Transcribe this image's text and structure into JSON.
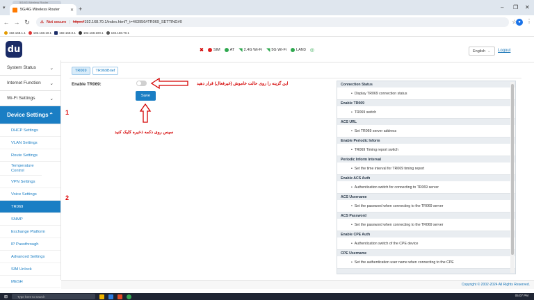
{
  "browser": {
    "tab_title": "5G/4G Wireless Router",
    "ghost_tab": "5G/4G Wireless Router",
    "security_warning": "Not secure",
    "url_scheme": "https://",
    "url_rest": "192.168.70.1/index.html?_t=463956#TR069_SETTING#0",
    "bookmarks": [
      "192.168.1.1",
      "192.168.10.1",
      "192.168.0.1",
      "192.168.100.1",
      "192.168.70.1"
    ]
  },
  "header": {
    "logo_text": "du",
    "status": [
      {
        "label": "",
        "icon": "sim-x-icon",
        "color": "#d00000"
      },
      {
        "label": "SIM",
        "icon": "dot",
        "color": "#e02020"
      },
      {
        "label": "AT",
        "icon": "dot",
        "color": "#2fa84f"
      },
      {
        "label": "2.4G Wi-Fi",
        "icon": "wifi-icon",
        "color": "#2fa84f"
      },
      {
        "label": "5G Wi-Fi",
        "icon": "wifi-icon",
        "color": "#2fa84f"
      },
      {
        "label": "LAN3",
        "icon": "dot",
        "color": "#2fa84f"
      }
    ],
    "language": "English",
    "logout": "Logout"
  },
  "sidebar": {
    "menus": [
      "System Status",
      "Internet Function",
      "Wi-Fi Settings"
    ],
    "active_menu": "Device Settings",
    "items": [
      "DHCP Settings",
      "VLAN Settings",
      "Route Settings",
      "Temperature Control",
      "VPN Settings",
      "Voice Settings",
      "TR069",
      "SNMP",
      "Exchange Platform",
      "IP Passthrough",
      "Advanced Settings",
      "SIM Unlock",
      "MESH"
    ],
    "selected_item": "TR069"
  },
  "content": {
    "tabs": [
      "TR069",
      "TR069Brief"
    ],
    "active_tab": "TR069",
    "enable_label": "Enable TR069:",
    "toggle_state": "off",
    "save_label": "Save"
  },
  "annotations": {
    "num1": "1",
    "num2": "2",
    "text1": "این گزینه را روی حالت خاموش (غیرفعال) قرار دهید",
    "text2": "سپس روی دکمه ذخیره کلیک کنید"
  },
  "help": [
    {
      "title": "Connection Status",
      "desc": "Display TR069 connection status"
    },
    {
      "title": "Enable TR069",
      "desc": "TR069 switch"
    },
    {
      "title": "ACS URL",
      "desc": "Set TR069 server address"
    },
    {
      "title": "Enable Periodic Inform",
      "desc": "TR069 Timing report switch"
    },
    {
      "title": "Periodic Inform Interval",
      "desc": "Set the time interval for TR069 timing report"
    },
    {
      "title": "Enable ACS Auth",
      "desc": "Authentication switch for connecting to TR069 server"
    },
    {
      "title": "ACS Username",
      "desc": "Set the password when connecting to the TR069 server"
    },
    {
      "title": "ACS Password",
      "desc": "Set the password when connecting to the TR069 server"
    },
    {
      "title": "Enable CPE Auth",
      "desc": "Authentication switch of the CPE device"
    },
    {
      "title": "CPE Username",
      "desc": "Set the authentication user name when connecting to the CPE"
    }
  ],
  "footer": "Copyright © 2002-2024 All Rights Reserved.",
  "taskbar": {
    "search": "Type here to search",
    "time": "05:07 PM"
  }
}
